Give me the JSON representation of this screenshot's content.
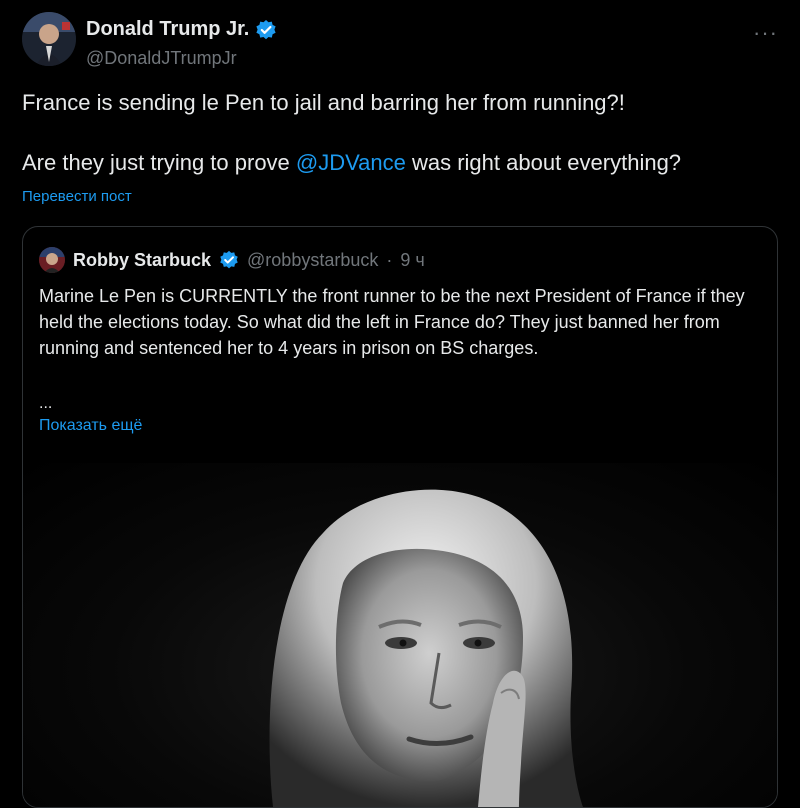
{
  "post": {
    "author_name": "Donald Trump Jr.",
    "author_handle": "@DonaldJTrumpJr",
    "more_icon": "more-dots-icon",
    "text_line1": "France is sending le Pen to jail and barring her from running?!",
    "text_line2_before": "Are they just trying to prove ",
    "text_line2_mention": "@JDVance",
    "text_line2_after": " was right about everything?",
    "translate_label": "Перевести пост"
  },
  "quote": {
    "author_name": "Robby Starbuck",
    "author_handle": "@robbystarbuck",
    "separator": "·",
    "time": "9 ч",
    "text": "Marine Le Pen is CURRENTLY the front runner to be the next President of France if they held the elections today. So what did the left in France do? They just banned her from running and sentenced her to 4 years in prison on BS charges.",
    "ellipsis": "...",
    "show_more_label": "Показать ещё"
  },
  "colors": {
    "background": "#000000",
    "text": "#e7e9ea",
    "secondary_text": "#71767b",
    "link": "#1d9bf0",
    "border": "#2f3336"
  }
}
